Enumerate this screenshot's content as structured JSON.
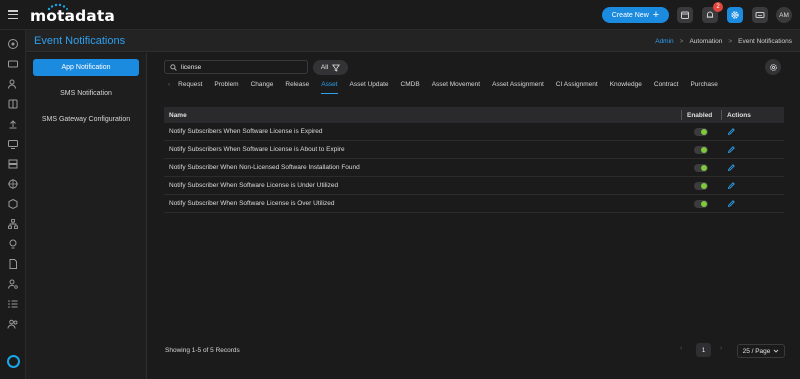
{
  "app": {
    "logo_text": "motadata"
  },
  "topbar": {
    "create_label": "Create New",
    "create_plus": "+",
    "notification_count": "2",
    "avatar_initials": "AM",
    "accent_color": "#1b8be0"
  },
  "header": {
    "title": "Event Notifications",
    "breadcrumbs": [
      {
        "label": "Admin"
      },
      {
        "label": "Automation"
      },
      {
        "label": "Event Notifications"
      }
    ],
    "separator": ">"
  },
  "sidemenu": {
    "items": [
      {
        "label": "App Notification",
        "active": true
      },
      {
        "label": "SMS Notification",
        "active": false
      },
      {
        "label": "SMS Gateway Configuration",
        "active": false
      }
    ]
  },
  "search": {
    "value": "license",
    "placeholder": "Search"
  },
  "filter": {
    "label": "All"
  },
  "tabs": {
    "chevron": "‹",
    "items": [
      {
        "label": "Request"
      },
      {
        "label": "Problem"
      },
      {
        "label": "Change"
      },
      {
        "label": "Release"
      },
      {
        "label": "Asset",
        "active": true
      },
      {
        "label": "Asset Update"
      },
      {
        "label": "CMDB"
      },
      {
        "label": "Asset Movement"
      },
      {
        "label": "Asset Assignment"
      },
      {
        "label": "CI Assignment"
      },
      {
        "label": "Knowledge"
      },
      {
        "label": "Contract"
      },
      {
        "label": "Purchase"
      }
    ]
  },
  "table": {
    "columns": {
      "name": "Name",
      "enabled": "Enabled",
      "actions": "Actions"
    },
    "rows": [
      {
        "name": "Notify Subscribers When Software License is Expired",
        "enabled": true
      },
      {
        "name": "Notify Subscribers When Software License is About to Expire",
        "enabled": true
      },
      {
        "name": "Notify Subscriber When Non-Licensed Software Installation Found",
        "enabled": true
      },
      {
        "name": "Notify Subscriber When Software License is Under Utilized",
        "enabled": true
      },
      {
        "name": "Notify Subscriber When Software License is Over Utilized",
        "enabled": true
      }
    ]
  },
  "footer": {
    "records_text": "Showing 1-5 of 5 Records",
    "prev": "‹",
    "next": "›",
    "current_page": "1",
    "page_size": "25 / Page"
  }
}
